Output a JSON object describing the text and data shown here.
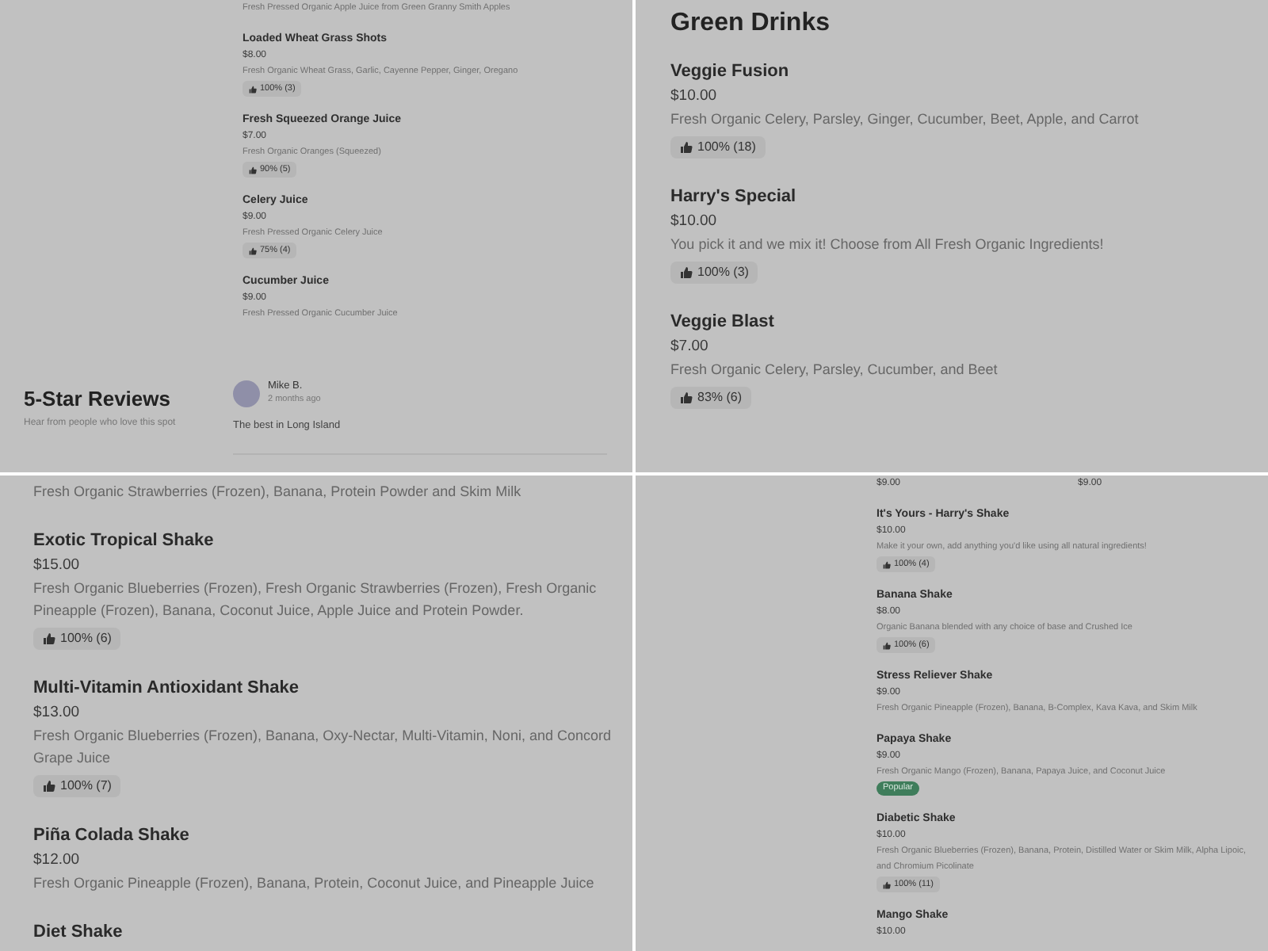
{
  "panels": [
    {
      "kind": "small",
      "lead_description": "Fresh Pressed Organic Apple Juice from Green Granny Smith Apples",
      "items": [
        {
          "name": "Loaded Wheat Grass Shots",
          "price": "$8.00",
          "description": "Fresh Organic Wheat Grass, Garlic, Cayenne Pepper, Ginger, Oregano",
          "rating": "100% (3)"
        },
        {
          "name": "Fresh Squeezed Orange Juice",
          "price": "$7.00",
          "description": "Fresh Organic Oranges (Squeezed)",
          "rating": "90% (5)"
        },
        {
          "name": "Celery Juice",
          "price": "$9.00",
          "description": "Fresh Pressed Organic Celery Juice",
          "rating": "75% (4)"
        },
        {
          "name": "Cucumber Juice",
          "price": "$9.00",
          "description": "Fresh Pressed Organic Cucumber Juice"
        }
      ],
      "reviews": {
        "title": "5-Star Reviews",
        "subtitle": "Hear from people who love this spot",
        "review": {
          "author": "Mike B.",
          "time": "2 months ago",
          "text": "The best in Long Island"
        }
      }
    },
    {
      "kind": "large",
      "title": "Green Drinks",
      "items": [
        {
          "name": "Veggie Fusion",
          "price": "$10.00",
          "description": "Fresh Organic Celery, Parsley, Ginger, Cucumber, Beet, Apple, and Carrot",
          "rating": "100% (18)"
        },
        {
          "name": "Harry's Special",
          "price": "$10.00",
          "description": "You pick it and we mix it! Choose from All Fresh Organic Ingredients!",
          "rating": "100% (3)"
        },
        {
          "name": "Veggie Blast",
          "price": "$7.00",
          "description": "Fresh Organic Celery, Parsley, Cucumber, and Beet",
          "rating": "83% (6)"
        }
      ]
    },
    {
      "kind": "large",
      "lead_description": "Fresh Organic Strawberries (Frozen), Banana, Protein Powder and Skim Milk",
      "items": [
        {
          "name": "Exotic Tropical Shake",
          "price": "$15.00",
          "description": "Fresh Organic Blueberries (Frozen), Fresh Organic Strawberries (Frozen), Fresh Organic Pineapple (Frozen), Banana, Coconut Juice, Apple Juice and Protein Powder.",
          "rating": "100% (6)"
        },
        {
          "name": "Multi-Vitamin Antioxidant Shake",
          "price": "$13.00",
          "description": "Fresh Organic Blueberries (Frozen), Banana, Oxy-Nectar, Multi-Vitamin, Noni, and Concord Grape Juice",
          "rating": "100% (7)"
        },
        {
          "name": "Piña Colada Shake",
          "price": "$12.00",
          "description": "Fresh Organic Pineapple (Frozen), Banana, Protein, Coconut Juice, and Pineapple Juice"
        },
        {
          "name": "Diet Shake"
        }
      ]
    },
    {
      "kind": "small",
      "lead_prices": [
        "$9.00",
        "$9.00"
      ],
      "items": [
        {
          "name": "It's Yours - Harry's Shake",
          "price": "$10.00",
          "description": "Make it your own, add anything you'd like using all natural ingredients!",
          "rating": "100% (4)"
        },
        {
          "name": "Banana Shake",
          "price": "$8.00",
          "description": "Organic Banana blended with any choice of base and Crushed Ice",
          "rating": "100% (6)"
        },
        {
          "name": "Stress Reliever Shake",
          "price": "$9.00",
          "description": "Fresh Organic Pineapple (Frozen), Banana, B-Complex, Kava Kava, and Skim Milk"
        },
        {
          "name": "Papaya Shake",
          "price": "$9.00",
          "description": "Fresh Organic Mango (Frozen), Banana, Papaya Juice, and Coconut Juice",
          "badge": "Popular"
        },
        {
          "name": "Diabetic Shake",
          "price": "$10.00",
          "description": "Fresh Organic Blueberries (Frozen), Banana, Protein, Distilled Water or Skim Milk, Alpha Lipoic, and Chromium Picolinate",
          "rating": "100% (11)"
        },
        {
          "name": "Mango Shake",
          "price": "$10.00"
        }
      ]
    }
  ]
}
